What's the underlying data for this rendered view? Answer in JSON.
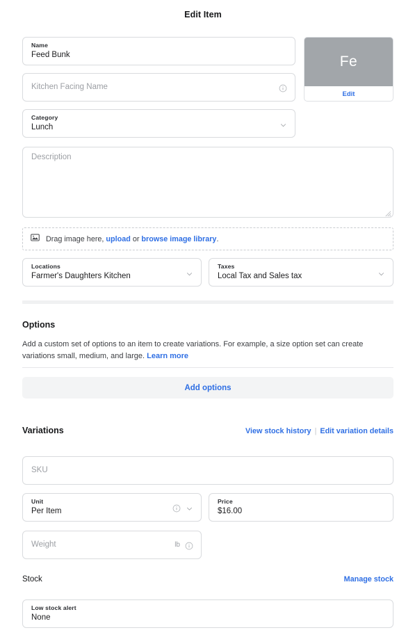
{
  "header": {
    "title": "Edit Item"
  },
  "thumbnail": {
    "initials": "Fe",
    "edit_label": "Edit",
    "bg_color": "#a2a6aa"
  },
  "fields": {
    "name": {
      "label": "Name",
      "value": "Feed Bunk"
    },
    "kitchen_facing_name": {
      "placeholder": "Kitchen Facing Name",
      "info_icon": "info-icon"
    },
    "category": {
      "label": "Category",
      "value": "Lunch",
      "chevron_icon": "chevron-down-icon"
    },
    "description": {
      "placeholder": "Description"
    },
    "locations": {
      "label": "Locations",
      "value": "Farmer's Daughters Kitchen",
      "chevron_icon": "chevron-down-icon"
    },
    "taxes": {
      "label": "Taxes",
      "value": "Local Tax and Sales tax",
      "chevron_icon": "chevron-down-icon"
    },
    "sku": {
      "placeholder": "SKU"
    },
    "unit": {
      "label": "Unit",
      "value": "Per Item",
      "info_icon": "info-icon",
      "chevron_icon": "chevron-down-icon"
    },
    "price": {
      "label": "Price",
      "value": "$16.00"
    },
    "weight": {
      "placeholder": "Weight",
      "unit_suffix": "lb",
      "info_icon": "info-icon"
    },
    "low_stock_alert": {
      "label": "Low stock alert",
      "value": "None"
    }
  },
  "dropzone": {
    "icon": "image-icon",
    "text_before": "Drag image here,",
    "upload_link": "upload",
    "text_middle": "or",
    "browse_link": "browse image library",
    "text_after": "."
  },
  "options": {
    "heading": "Options",
    "description_part1": "Add a custom set of options to an item to create variations. For example, a size option set can create variations small, medium, and large.",
    "learn_more_link": "Learn more",
    "add_options_label": "Add options"
  },
  "variations": {
    "heading": "Variations",
    "view_stock_history_link": "View stock history",
    "separator": "|",
    "edit_variation_details_link": "Edit variation details"
  },
  "stock": {
    "heading": "Stock",
    "manage_stock_link": "Manage stock"
  },
  "colors": {
    "accent_blue": "#2f6fe4",
    "border": "#d9dbde",
    "placeholder_text": "#9b9ea3",
    "divider_thick": "#f0f1f2",
    "button_bg": "#f3f4f5"
  }
}
